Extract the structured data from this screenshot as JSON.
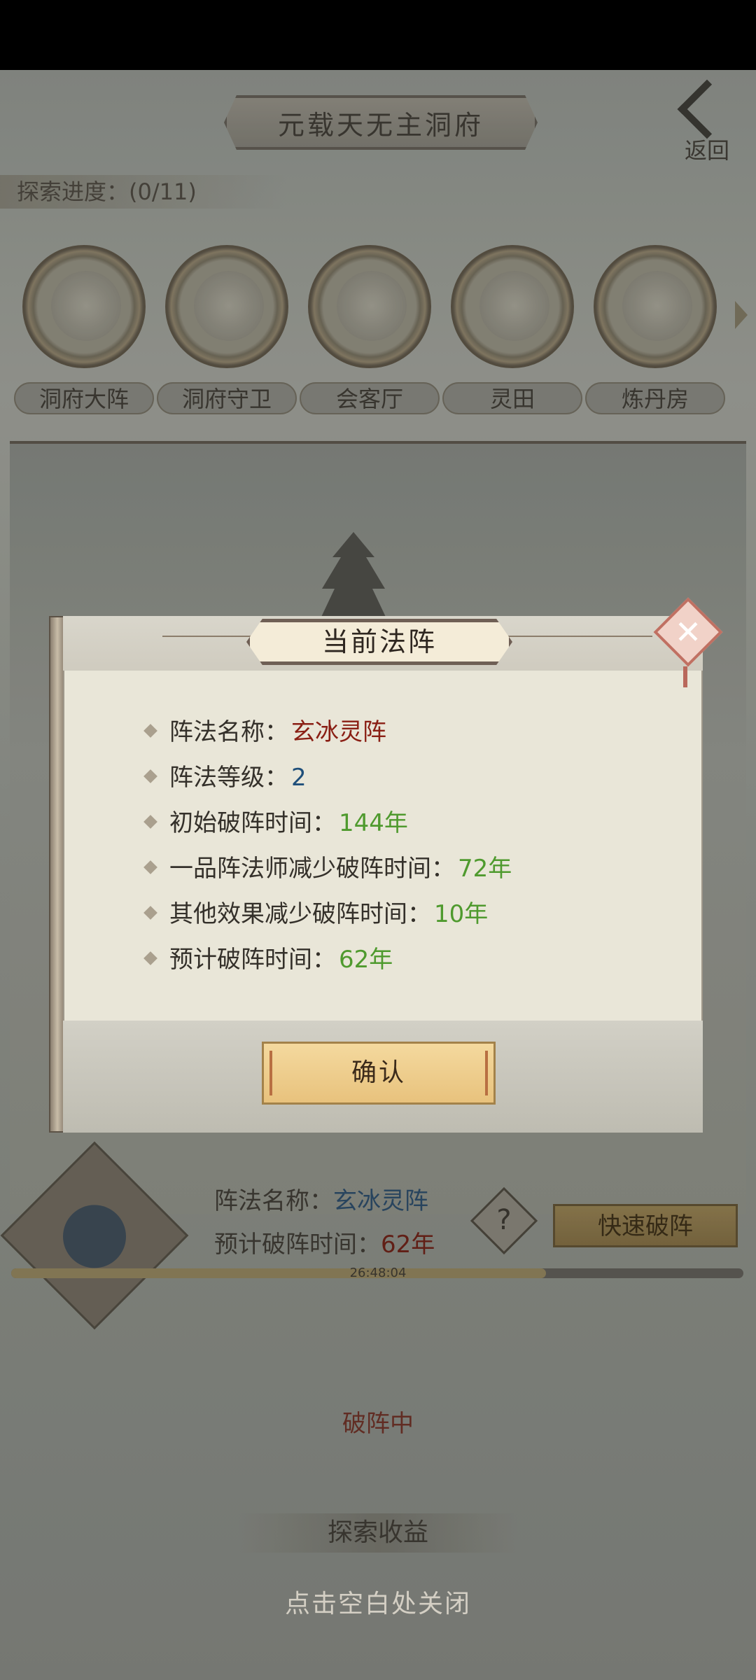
{
  "header": {
    "title": "元载天无主洞府",
    "back_label": "返回"
  },
  "explore_progress": "探索进度：(0/11)",
  "buildings": [
    {
      "label": "洞府大阵"
    },
    {
      "label": "洞府守卫"
    },
    {
      "label": "会客厅"
    },
    {
      "label": "灵田"
    },
    {
      "label": "炼丹房"
    }
  ],
  "formation": {
    "name_label": "阵法名称：",
    "name_value": "玄冰灵阵",
    "eta_label": "预计破阵时间：",
    "eta_value": "62年",
    "quick_break": "快速破阵",
    "help": "?",
    "timer": "26:48:04",
    "progress": 0.73,
    "status": "破阵中"
  },
  "section_title": "探索收益",
  "close_hint": "点击空白处关闭",
  "dialog": {
    "title": "当前法阵",
    "rows": [
      {
        "label": "阵法名称：",
        "value": "玄冰灵阵",
        "color": "#8a1f14"
      },
      {
        "label": "阵法等级：",
        "value": "2",
        "color": "#1f4f7a"
      },
      {
        "label": "初始破阵时间：",
        "value": "144年",
        "color": "#4f9a2e"
      },
      {
        "label": "一品阵法师减少破阵时间：",
        "value": "72年",
        "color": "#4f9a2e"
      },
      {
        "label": "其他效果减少破阵时间：",
        "value": "10年",
        "color": "#4f9a2e"
      },
      {
        "label": "预计破阵时间：",
        "value": "62年",
        "color": "#4f9a2e"
      }
    ],
    "confirm": "确认"
  }
}
